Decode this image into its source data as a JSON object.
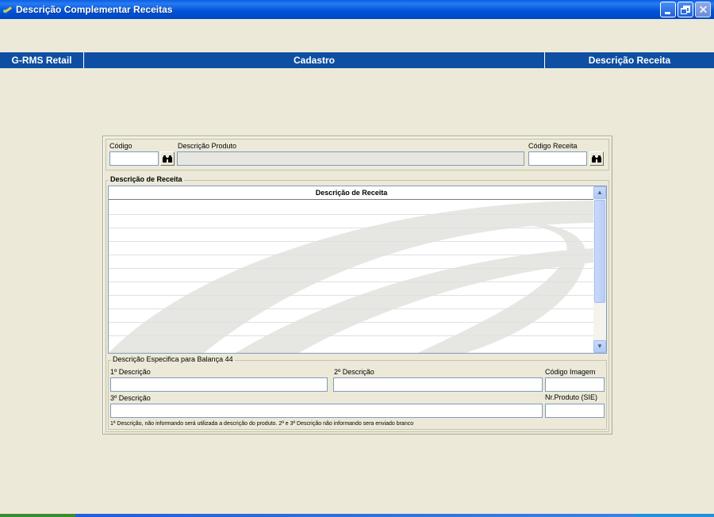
{
  "window": {
    "title": "Descrição Complementar Receitas"
  },
  "header": {
    "left": "G-RMS Retail",
    "center": "Cadastro",
    "right": "Descrição Receita"
  },
  "top": {
    "codigo_label": "Código",
    "codigo_value": "",
    "desc_produto_label": "Descrição Produto",
    "desc_produto_value": "",
    "codigo_receita_label": "Código Receita",
    "codigo_receita_value": ""
  },
  "receita_group": {
    "title": "Descrição de Receita",
    "grid_header": "Descrição de Receita",
    "rows": []
  },
  "balanca_group": {
    "title": "Descrição Especifica para Balança 44",
    "desc1_label": "1º Descrição",
    "desc1_value": "",
    "desc2_label": "2º Descrição",
    "desc2_value": "",
    "codigo_imagem_label": "Código Imagem",
    "codigo_imagem_value": "",
    "desc3_label": "3º Descrição",
    "desc3_value": "",
    "nr_produto_label": "Nr.Produto (SIE)",
    "nr_produto_value": "",
    "note": "1ª Descrição, não informando será utilizada a descrição do produto. 2ª e 3ª Descrição não informando sera enviado branco"
  },
  "icons": {
    "find": "binoculars-icon",
    "app": "app-icon"
  },
  "colors": {
    "titlebar": "#0055D8",
    "header_bar": "#0E4FA3",
    "background": "#ECE9D8"
  }
}
